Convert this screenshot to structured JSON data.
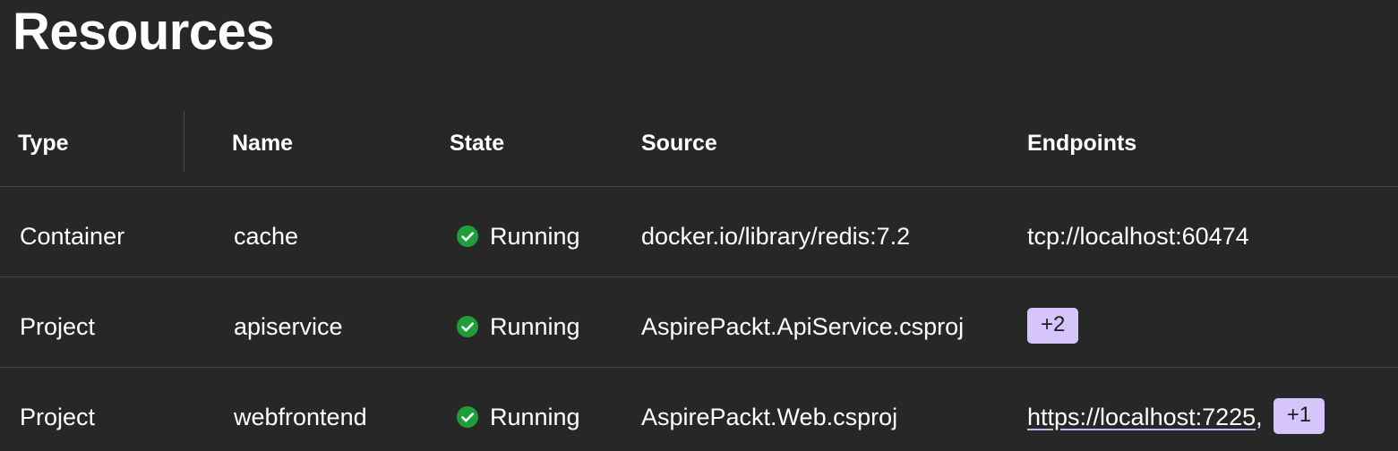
{
  "page": {
    "title": "Resources"
  },
  "table": {
    "headers": {
      "type": "Type",
      "name": "Name",
      "state": "State",
      "source": "Source",
      "endpoints": "Endpoints"
    },
    "rows": [
      {
        "type": "Container",
        "name": "cache",
        "state": "Running",
        "state_icon": "check-circle-icon",
        "source": "docker.io/library/redis:7.2",
        "endpoint_text": "tcp://localhost:60474"
      },
      {
        "type": "Project",
        "name": "apiservice",
        "state": "Running",
        "state_icon": "check-circle-icon",
        "source": "AspirePackt.ApiService.csproj",
        "endpoint_badge": "+2"
      },
      {
        "type": "Project",
        "name": "webfrontend",
        "state": "Running",
        "state_icon": "check-circle-icon",
        "source": "AspirePackt.Web.csproj",
        "endpoint_link": "https://localhost:7225",
        "endpoint_separator": ",",
        "endpoint_badge": "+1"
      }
    ]
  },
  "colors": {
    "background": "#272727",
    "text": "#ffffff",
    "running_green": "#1f9d3a",
    "badge_bg": "#d6c5fa",
    "divider": "#444444"
  }
}
